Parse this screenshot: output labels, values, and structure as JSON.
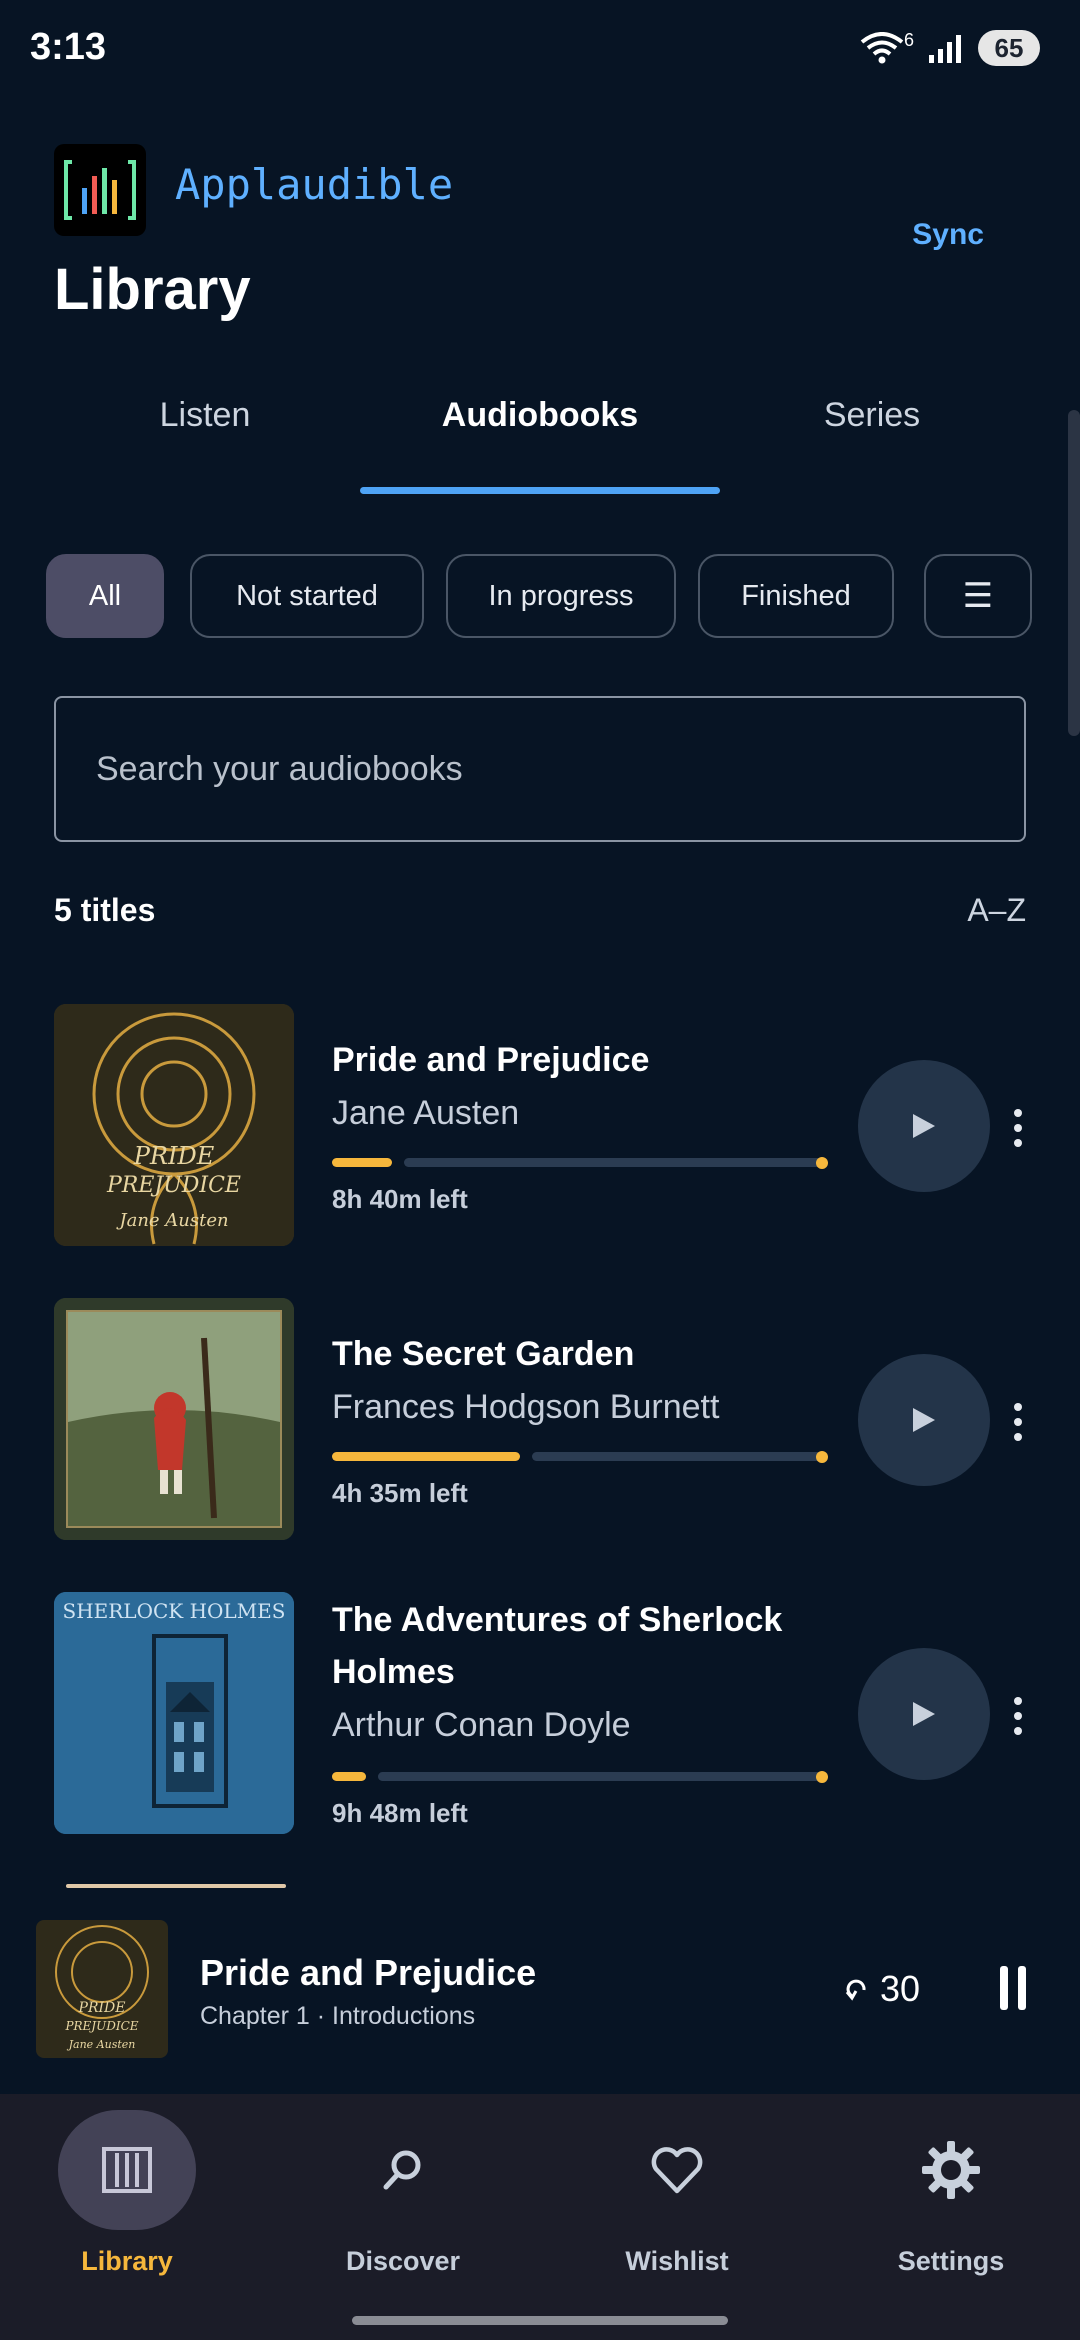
{
  "status_bar": {
    "time": "3:13",
    "wifi_badge": "6",
    "battery": "65"
  },
  "header": {
    "app_name": "Applaudible",
    "sync_label": "Sync",
    "page_title": "Library"
  },
  "tabs": [
    {
      "label": "Listen",
      "active": false
    },
    {
      "label": "Audiobooks",
      "active": true
    },
    {
      "label": "Series",
      "active": false
    }
  ],
  "filters": {
    "chips": [
      {
        "label": "All",
        "active": true
      },
      {
        "label": "Not started",
        "active": false
      },
      {
        "label": "In progress",
        "active": false
      },
      {
        "label": "Finished",
        "active": false
      }
    ],
    "menu_glyph": "☰"
  },
  "search": {
    "placeholder": "Search your audiobooks"
  },
  "list_header": {
    "count": "5 titles",
    "sort": "A–Z"
  },
  "books": [
    {
      "title": "Pride and Prejudice",
      "author": "Jane Austen",
      "time_left": "8h 40m left",
      "progress": 0.12,
      "cover_text": "PRIDE and PREJUDICE by Jane Austen",
      "cover_color": "#3a3420"
    },
    {
      "title": "The Secret Garden",
      "author": "Frances Hodgson Burnett",
      "time_left": "4h 35m left",
      "progress": 0.38,
      "cover_color": "#3b4a2c"
    },
    {
      "title": "The Adventures of Sherlock Holmes",
      "author": "Arthur Conan Doyle",
      "time_left": "9h 48m left",
      "progress": 0.07,
      "cover_text": "SHERLOCK HOLMES",
      "cover_color": "#2f6e9c"
    }
  ],
  "mini_player": {
    "title": "Pride and Prejudice",
    "subtitle": "Chapter 1 · Introductions",
    "rewind": "30"
  },
  "nav": [
    {
      "label": "Library",
      "icon": "library-icon",
      "active": true
    },
    {
      "label": "Discover",
      "icon": "search-icon",
      "active": false
    },
    {
      "label": "Wishlist",
      "icon": "heart-icon",
      "active": false
    },
    {
      "label": "Settings",
      "icon": "gear-icon",
      "active": false
    }
  ],
  "colors": {
    "accent": "#4ea3f5",
    "progress": "#f6b73c",
    "background": "#071424",
    "nav_active": "#f6b73c"
  }
}
